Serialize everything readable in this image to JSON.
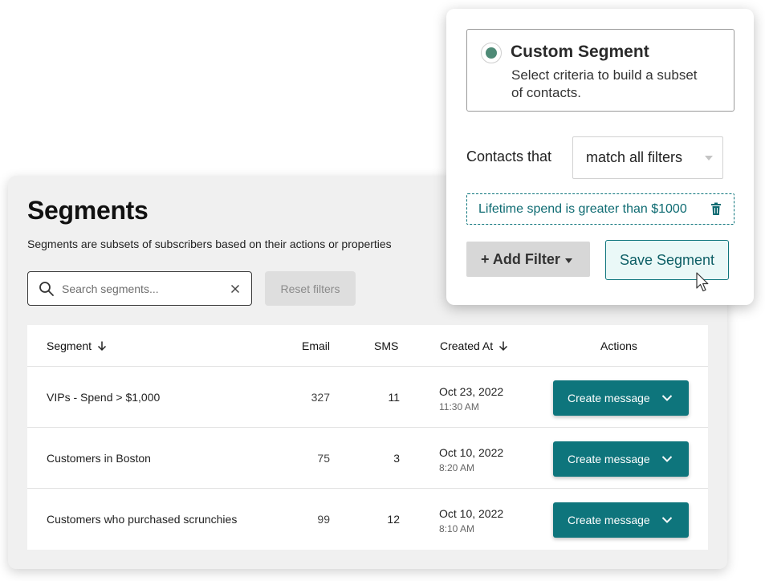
{
  "header": {
    "title": "Segments",
    "subtitle": "Segments are subsets of subscribers based on their actions or properties"
  },
  "search": {
    "placeholder": "Search segments...",
    "value": ""
  },
  "reset_label": "Reset filters",
  "table": {
    "columns": [
      "Segment",
      "Email",
      "SMS",
      "Created At",
      "Actions"
    ],
    "rows": [
      {
        "name": "VIPs - Spend > $1,000",
        "email": "327",
        "sms": "11",
        "date": "Oct 23, 2022",
        "time": "11:30 AM",
        "action": "Create message"
      },
      {
        "name": "Customers in Boston",
        "email": "75",
        "sms": "3",
        "date": "Oct 10, 2022",
        "time": "8:20 AM",
        "action": "Create message"
      },
      {
        "name": "Customers who purchased scrunchies",
        "email": "99",
        "sms": "12",
        "date": "Oct 10, 2022",
        "time": "8:10 AM",
        "action": "Create message"
      }
    ]
  },
  "popover": {
    "option_title": "Custom Segment",
    "option_desc": "Select criteria to build a subset of contacts.",
    "contacts_label": "Contacts that",
    "match_value": "match all filters",
    "filter_text": "Lifetime spend is greater than $1000",
    "add_filter_label": "+ Add Filter",
    "save_label": "Save Segment"
  },
  "colors": {
    "accent": "#0e757c",
    "radio": "#4e8a76",
    "card_bg": "#f0f0f0"
  },
  "icons": [
    "search-icon",
    "close-icon",
    "arrow-down-icon",
    "chevron-down-icon",
    "caret-down-icon",
    "trash-icon",
    "cursor-icon"
  ]
}
